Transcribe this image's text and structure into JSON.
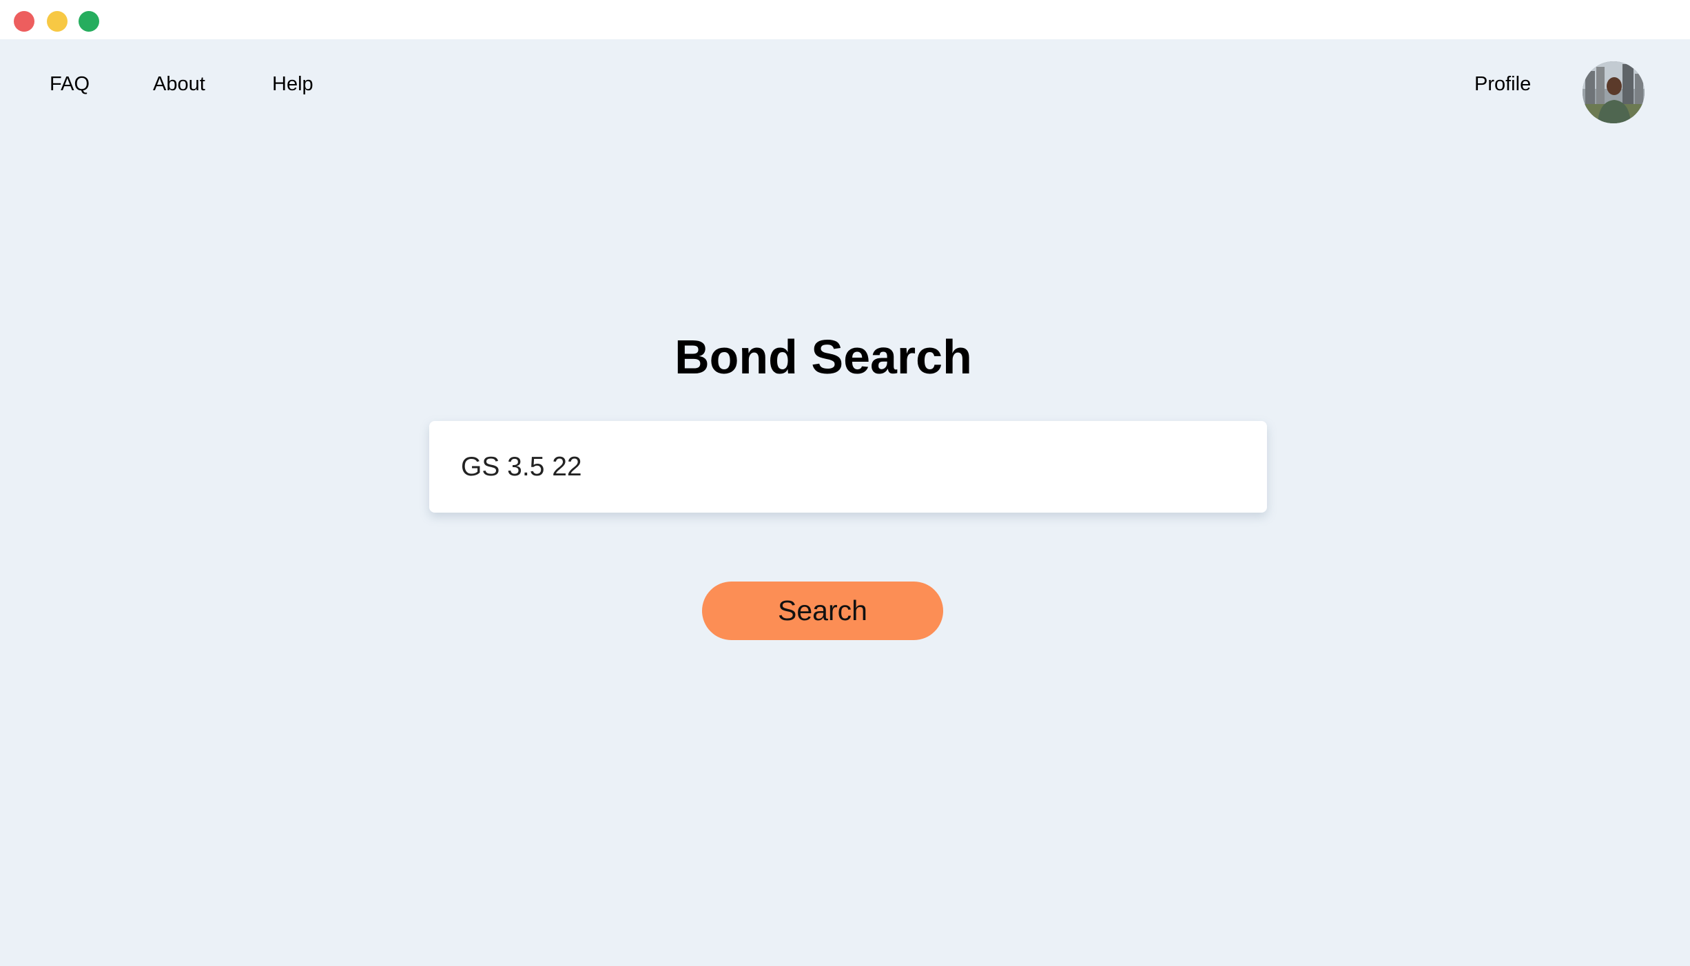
{
  "window": {
    "controls": [
      {
        "name": "close",
        "color": "#ed5e5e"
      },
      {
        "name": "minimize",
        "color": "#f7c844"
      },
      {
        "name": "zoom",
        "color": "#26ad5e"
      }
    ]
  },
  "nav": {
    "left_items": [
      {
        "label": "FAQ"
      },
      {
        "label": "About"
      },
      {
        "label": "Help"
      }
    ],
    "profile_label": "Profile"
  },
  "main": {
    "title": "Bond Search",
    "search": {
      "value": "GS 3.5 22",
      "placeholder": ""
    },
    "search_button_label": "Search"
  },
  "colors": {
    "background": "#ebf1f7",
    "accent": "#fc8e55",
    "titlebar": "#ffffff"
  }
}
